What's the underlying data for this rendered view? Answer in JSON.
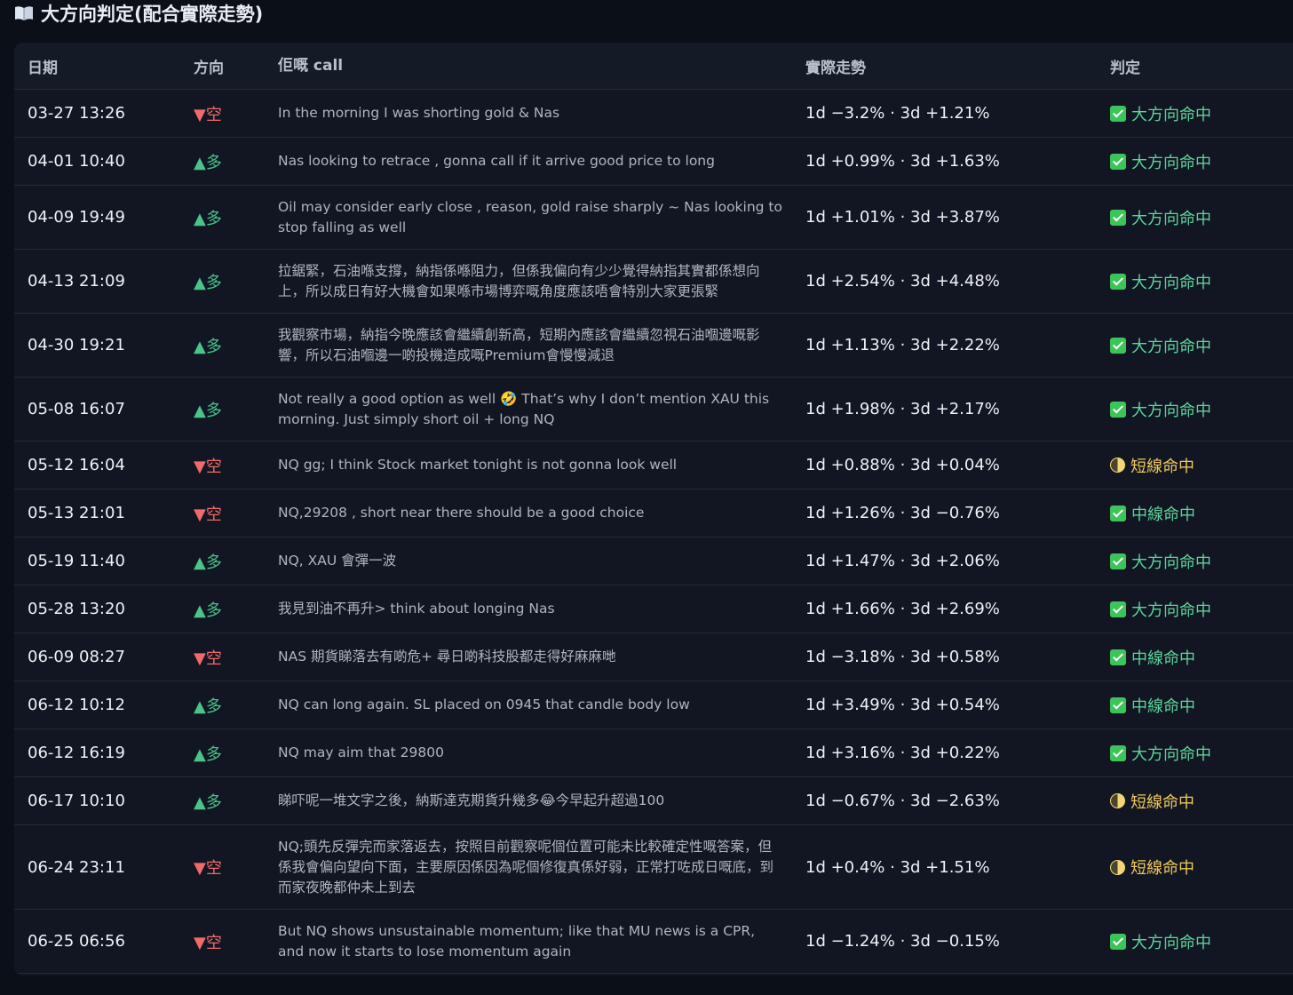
{
  "section": {
    "title": "大方向判定(配合實際走勢)",
    "icon": "open-book-icon"
  },
  "table": {
    "headers": {
      "date": "日期",
      "direction": "方向",
      "call": "佢嘅 call",
      "movement": "實際走勢",
      "verdict": "判定"
    },
    "rows": [
      {
        "date": "03-27 13:26",
        "dir": "▼空",
        "dir_type": "down",
        "call": "In the morning I was shorting gold & Nas",
        "move": "1d −3.2% · 3d +1.21%",
        "verdict": "大方向命中",
        "verdict_type": "check"
      },
      {
        "date": "04-01 10:40",
        "dir": "▲多",
        "dir_type": "up",
        "call": "Nas looking to retrace , gonna call if it arrive good price to long",
        "move": "1d +0.99% · 3d +1.63%",
        "verdict": "大方向命中",
        "verdict_type": "check"
      },
      {
        "date": "04-09 19:49",
        "dir": "▲多",
        "dir_type": "up",
        "call": "Oil may consider early close , reason, gold raise sharply ~ Nas looking to stop falling as well",
        "move": "1d +1.01% · 3d +3.87%",
        "verdict": "大方向命中",
        "verdict_type": "check"
      },
      {
        "date": "04-13 21:09",
        "dir": "▲多",
        "dir_type": "up",
        "call": "拉鋸緊，石油喺支撐，納指係喺阻力，但係我偏向有少少覺得納指其實都係想向上，所以成日有好大機會如果喺市場博弈嘅角度應該唔會特別大家更張緊",
        "move": "1d +2.54% · 3d +4.48%",
        "verdict": "大方向命中",
        "verdict_type": "check"
      },
      {
        "date": "04-30 19:21",
        "dir": "▲多",
        "dir_type": "up",
        "call": "我觀察市場，納指今晚應該會繼續創新高，短期內應該會繼續忽視石油嗰邊嘅影響，所以石油嗰邊一啲投機造成嘅Premium會慢慢減退",
        "move": "1d +1.13% · 3d +2.22%",
        "verdict": "大方向命中",
        "verdict_type": "check"
      },
      {
        "date": "05-08 16:07",
        "dir": "▲多",
        "dir_type": "up",
        "call": "Not really a good option as well 🤣 That’s why I don’t mention XAU this morning. Just simply short oil + long NQ",
        "move": "1d +1.98% · 3d +2.17%",
        "verdict": "大方向命中",
        "verdict_type": "check"
      },
      {
        "date": "05-12 16:04",
        "dir": "▼空",
        "dir_type": "down",
        "call": "NQ gg; I think Stock market tonight is not gonna look well",
        "move": "1d +0.88% · 3d +0.04%",
        "verdict": "短線命中",
        "verdict_type": "half"
      },
      {
        "date": "05-13 21:01",
        "dir": "▼空",
        "dir_type": "down",
        "call": "NQ,29208 , short near there should be a good choice",
        "move": "1d +1.26% · 3d −0.76%",
        "verdict": "中線命中",
        "verdict_type": "check"
      },
      {
        "date": "05-19 11:40",
        "dir": "▲多",
        "dir_type": "up",
        "call": "NQ, XAU 會彈一波",
        "move": "1d +1.47% · 3d +2.06%",
        "verdict": "大方向命中",
        "verdict_type": "check"
      },
      {
        "date": "05-28 13:20",
        "dir": "▲多",
        "dir_type": "up",
        "call": "我見到油不再升> think about longing Nas",
        "move": "1d +1.66% · 3d +2.69%",
        "verdict": "大方向命中",
        "verdict_type": "check"
      },
      {
        "date": "06-09 08:27",
        "dir": "▼空",
        "dir_type": "down",
        "call": "NAS 期貨睇落去有啲危+ 尋日啲科技股都走得好麻麻哋",
        "move": "1d −3.18% · 3d +0.58%",
        "verdict": "中線命中",
        "verdict_type": "check"
      },
      {
        "date": "06-12 10:12",
        "dir": "▲多",
        "dir_type": "up",
        "call": "NQ can long again. SL placed on 0945 that candle body low",
        "move": "1d +3.49% · 3d +0.54%",
        "verdict": "中線命中",
        "verdict_type": "check"
      },
      {
        "date": "06-12 16:19",
        "dir": "▲多",
        "dir_type": "up",
        "call": "NQ may aim that 29800",
        "move": "1d +3.16% · 3d +0.22%",
        "verdict": "大方向命中",
        "verdict_type": "check"
      },
      {
        "date": "06-17 10:10",
        "dir": "▲多",
        "dir_type": "up",
        "call": "睇吓呢一堆文字之後，納斯達克期貨升幾多😂今早起升超過100",
        "move": "1d −0.67% · 3d −2.63%",
        "verdict": "短線命中",
        "verdict_type": "half"
      },
      {
        "date": "06-24 23:11",
        "dir": "▼空",
        "dir_type": "down",
        "call": "NQ;頭先反彈完而家落返去，按照目前觀察呢個位置可能未比較確定性嘅答案，但係我會偏向望向下面，主要原因係因為呢個修復真係好弱，正常打咗成日嘅底，到而家夜晚都仲未上到去",
        "move": "1d +0.4% · 3d +1.51%",
        "verdict": "短線命中",
        "verdict_type": "half"
      },
      {
        "date": "06-25 06:56",
        "dir": "▼空",
        "dir_type": "down",
        "call": "But NQ shows unsustainable momentum; like that MU news is a CPR, and now it starts to lose momentum again",
        "move": "1d −1.24% · 3d −0.15%",
        "verdict": "大方向命中",
        "verdict_type": "check"
      }
    ]
  }
}
